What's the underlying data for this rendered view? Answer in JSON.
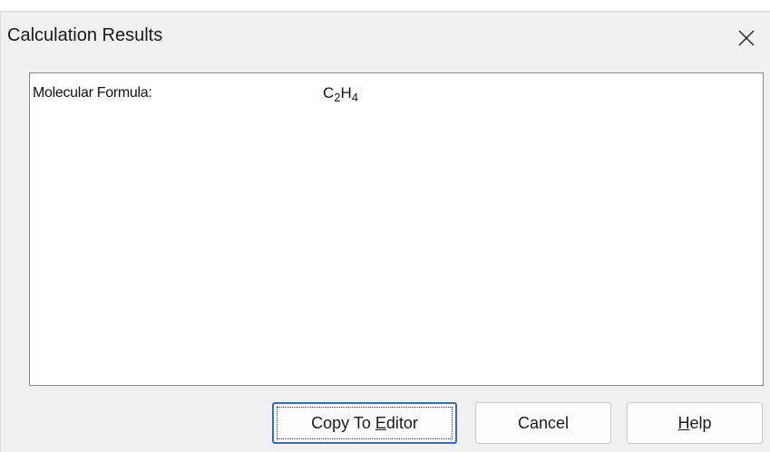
{
  "dialog": {
    "title": "Calculation Results",
    "close_icon": "close-icon"
  },
  "results": {
    "label": "Molecular Formula:",
    "formula": {
      "parts": [
        {
          "text": "C",
          "sub": "2"
        },
        {
          "text": "H",
          "sub": "4"
        }
      ]
    }
  },
  "buttons": {
    "copy": {
      "before": "Copy To ",
      "mnemonic": "E",
      "after": "ditor"
    },
    "cancel": {
      "label": "Cancel"
    },
    "help": {
      "before": "",
      "mnemonic": "H",
      "after": "elp"
    }
  },
  "colors": {
    "dialog_bg": "#f0f0f0",
    "pane_bg": "#ffffff",
    "focus_border": "#2b6cc4"
  }
}
